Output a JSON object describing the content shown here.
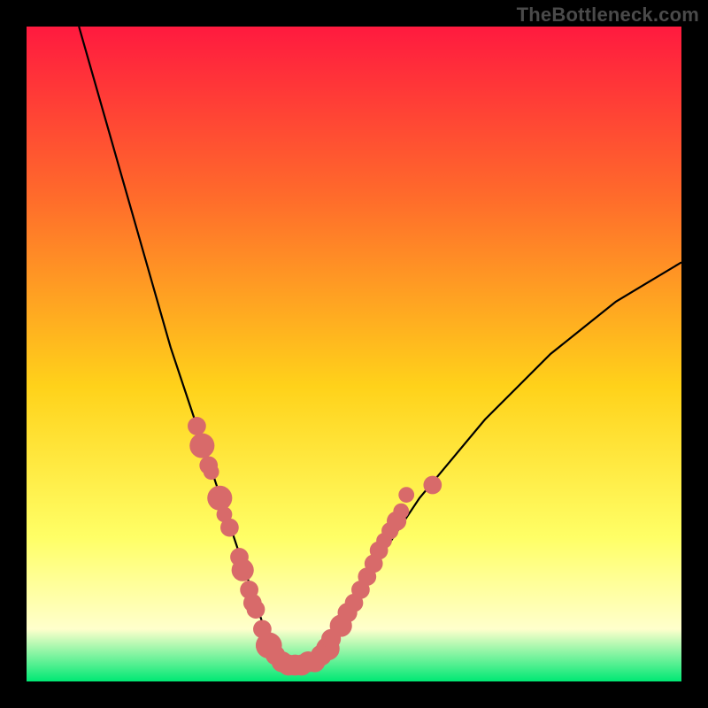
{
  "watermark": "TheBottleneck.com",
  "colors": {
    "frame": "#000000",
    "gradient_top": "#ff1a3f",
    "gradient_mid1": "#ff6b2b",
    "gradient_mid2": "#ffd21a",
    "gradient_mid3": "#ffff66",
    "gradient_pale": "#ffffcc",
    "gradient_bottom": "#00e874",
    "curve": "#000000",
    "marker_fill": "#d86a6a",
    "marker_stroke": "#c94f4f"
  },
  "chart_data": {
    "type": "line",
    "title": "",
    "xlabel": "",
    "ylabel": "",
    "xlim": [
      0,
      100
    ],
    "ylim": [
      0,
      100
    ],
    "series": [
      {
        "name": "bottleneck-curve",
        "x": [
          8,
          10,
          12,
          14,
          16,
          18,
          20,
          22,
          24,
          26,
          28,
          30,
          32,
          33,
          34,
          35,
          36,
          37,
          38,
          39,
          40,
          42,
          44,
          46,
          48,
          50,
          52,
          56,
          60,
          65,
          70,
          75,
          80,
          85,
          90,
          95,
          100
        ],
        "y": [
          100,
          93,
          86,
          79,
          72,
          65,
          58,
          51,
          45,
          39,
          33,
          27,
          21,
          18,
          15,
          12,
          9,
          6,
          4,
          3,
          2.5,
          2.5,
          3,
          5,
          8,
          12,
          16,
          22,
          28,
          34,
          40,
          45,
          50,
          54,
          58,
          61,
          64
        ]
      }
    ],
    "markers": [
      {
        "x": 26,
        "y": 39,
        "r": 1.4
      },
      {
        "x": 26.8,
        "y": 36,
        "r": 1.9
      },
      {
        "x": 27.8,
        "y": 33,
        "r": 1.4
      },
      {
        "x": 28.2,
        "y": 32,
        "r": 1.2
      },
      {
        "x": 29.5,
        "y": 28,
        "r": 1.9
      },
      {
        "x": 30.2,
        "y": 25.5,
        "r": 1.2
      },
      {
        "x": 31,
        "y": 23.5,
        "r": 1.4
      },
      {
        "x": 32.5,
        "y": 19,
        "r": 1.4
      },
      {
        "x": 33,
        "y": 17,
        "r": 1.7
      },
      {
        "x": 33.2,
        "y": 17.5,
        "r": 1.2
      },
      {
        "x": 34,
        "y": 14,
        "r": 1.4
      },
      {
        "x": 34.5,
        "y": 12,
        "r": 1.4
      },
      {
        "x": 35,
        "y": 11,
        "r": 1.4
      },
      {
        "x": 36,
        "y": 8,
        "r": 1.4
      },
      {
        "x": 36.5,
        "y": 5.5,
        "r": 1.5
      },
      {
        "x": 37,
        "y": 5.5,
        "r": 2.0
      },
      {
        "x": 38,
        "y": 4,
        "r": 1.5
      },
      {
        "x": 39,
        "y": 3,
        "r": 1.6
      },
      {
        "x": 40,
        "y": 2.5,
        "r": 1.6
      },
      {
        "x": 41,
        "y": 2.5,
        "r": 1.6
      },
      {
        "x": 42,
        "y": 2.5,
        "r": 1.6
      },
      {
        "x": 43,
        "y": 3,
        "r": 1.6
      },
      {
        "x": 44,
        "y": 3,
        "r": 1.6
      },
      {
        "x": 45,
        "y": 4,
        "r": 1.6
      },
      {
        "x": 46,
        "y": 5,
        "r": 1.8
      },
      {
        "x": 46.5,
        "y": 6.5,
        "r": 1.5
      },
      {
        "x": 48,
        "y": 8.5,
        "r": 1.7
      },
      {
        "x": 49,
        "y": 10.5,
        "r": 1.5
      },
      {
        "x": 50,
        "y": 12,
        "r": 1.4
      },
      {
        "x": 51,
        "y": 14,
        "r": 1.4
      },
      {
        "x": 52,
        "y": 16,
        "r": 1.4
      },
      {
        "x": 53,
        "y": 18,
        "r": 1.4
      },
      {
        "x": 53.8,
        "y": 20,
        "r": 1.4
      },
      {
        "x": 54.6,
        "y": 21.5,
        "r": 1.2
      },
      {
        "x": 55.5,
        "y": 23,
        "r": 1.3
      },
      {
        "x": 56.5,
        "y": 24.5,
        "r": 1.5
      },
      {
        "x": 57.2,
        "y": 26,
        "r": 1.2
      },
      {
        "x": 58,
        "y": 28.5,
        "r": 1.2
      },
      {
        "x": 62,
        "y": 30,
        "r": 1.4
      }
    ]
  }
}
